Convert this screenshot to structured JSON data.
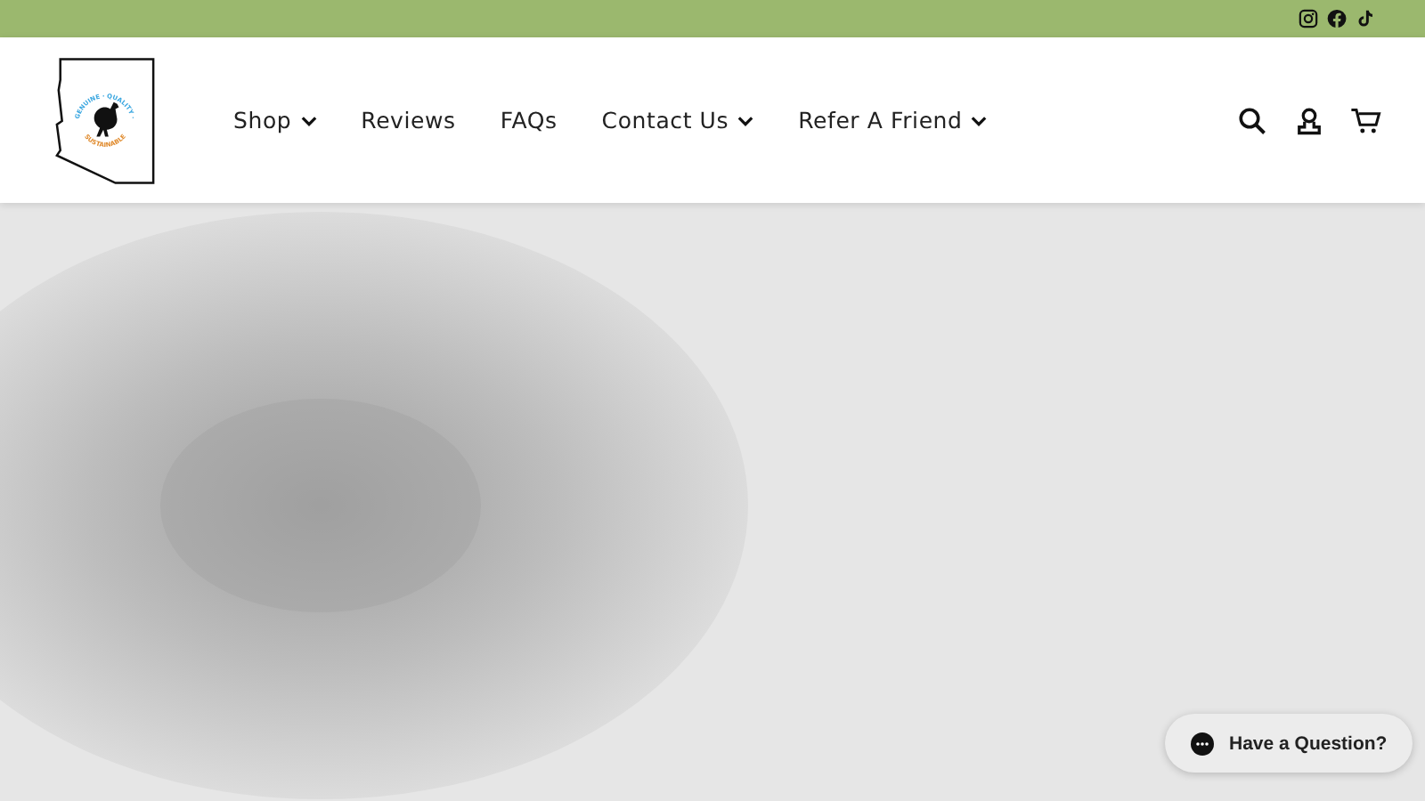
{
  "top_bar": {
    "social": [
      {
        "kind": "instagram"
      },
      {
        "kind": "facebook"
      },
      {
        "kind": "tiktok"
      }
    ]
  },
  "header": {
    "logo": {
      "top_text": "GENUINE · QUALITY ·",
      "bottom_text": "SUSTAINABLE"
    },
    "nav": [
      {
        "label": "Shop",
        "dropdown": true
      },
      {
        "label": "Reviews",
        "dropdown": false
      },
      {
        "label": "FAQs",
        "dropdown": false
      },
      {
        "label": "Contact Us",
        "dropdown": true
      },
      {
        "label": "Refer A Friend",
        "dropdown": true
      }
    ],
    "actions": [
      {
        "kind": "search"
      },
      {
        "kind": "account"
      },
      {
        "kind": "cart"
      }
    ]
  },
  "chat_button": {
    "label": "Have a Question?"
  }
}
